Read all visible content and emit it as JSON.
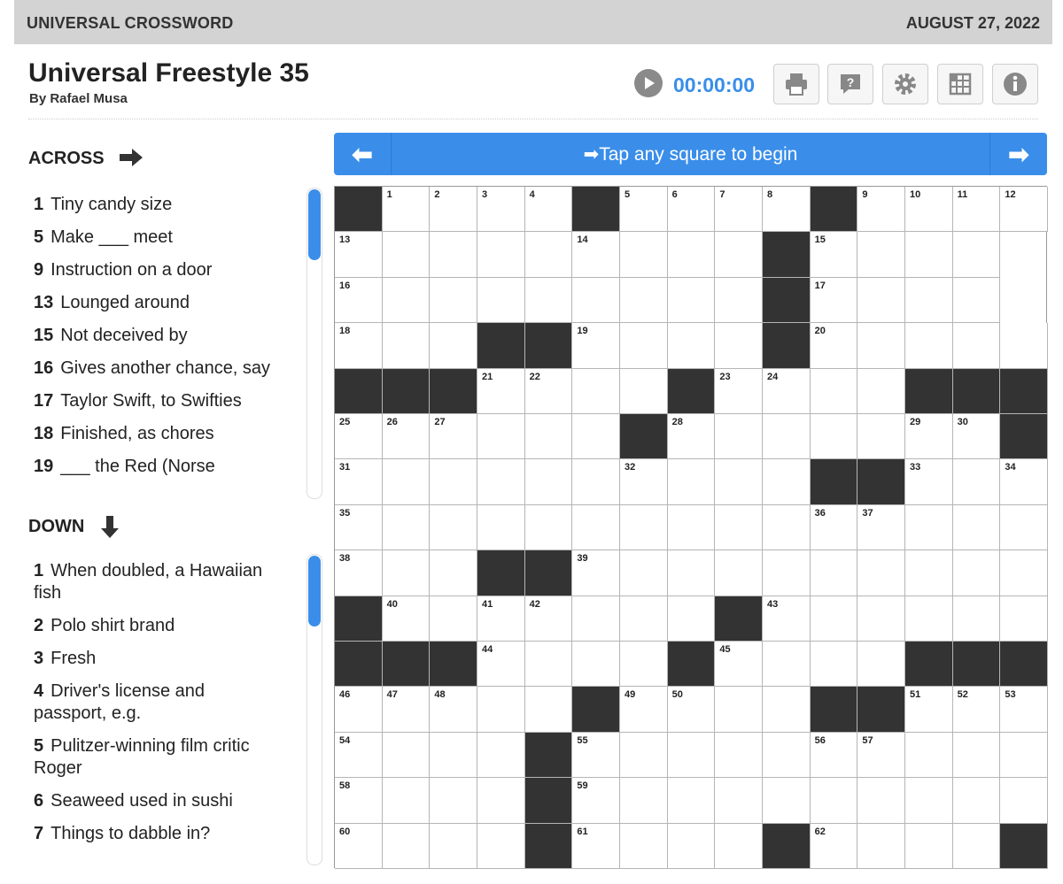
{
  "header": {
    "brand": "UNIVERSAL CROSSWORD",
    "date": "AUGUST 27, 2022"
  },
  "puzzle": {
    "title": "Universal Freestyle 35",
    "author": "By Rafael Musa"
  },
  "toolbar": {
    "timer": "00:00:00",
    "buttons": [
      "play-icon",
      "print-icon",
      "help-icon",
      "gear-icon",
      "grid-icon",
      "info-icon"
    ]
  },
  "banner": {
    "message": "➡Tap any square to begin",
    "prev": "⬅",
    "next": "➡"
  },
  "across": {
    "label": "ACROSS",
    "clues": [
      {
        "num": "1",
        "text": "Tiny candy size"
      },
      {
        "num": "5",
        "text": "Make ___ meet"
      },
      {
        "num": "9",
        "text": "Instruction on a door"
      },
      {
        "num": "13",
        "text": "Lounged around"
      },
      {
        "num": "15",
        "text": "Not deceived by"
      },
      {
        "num": "16",
        "text": "Gives another chance, say"
      },
      {
        "num": "17",
        "text": "Taylor Swift, to Swifties"
      },
      {
        "num": "18",
        "text": "Finished, as chores"
      },
      {
        "num": "19",
        "text": "___ the Red (Norse"
      }
    ]
  },
  "down": {
    "label": "DOWN",
    "clues": [
      {
        "num": "1",
        "text": "When doubled, a Hawaiian fish"
      },
      {
        "num": "2",
        "text": "Polo shirt brand"
      },
      {
        "num": "3",
        "text": "Fresh"
      },
      {
        "num": "4",
        "text": "Driver's license and passport, e.g."
      },
      {
        "num": "5",
        "text": "Pulitzer-winning film critic Roger"
      },
      {
        "num": "6",
        "text": "Seaweed used in sushi"
      },
      {
        "num": "7",
        "text": "Things to dabble in?"
      }
    ]
  },
  "grid": {
    "size": 15,
    "rows": [
      "#1 2 3 4 #5 6 7 8 #9 10 11 12",
      "13 . . . . 14 . . . # 15 . . .",
      "16 . . . . . . . . # 17 . . .",
      "18 . . # # 19 . . . # 20 . . . .",
      "# # # 21 22 . . # 23 24 . . # # #",
      "25 26 27 . . . # 28 . . . . 29 30 #",
      "31 . . . . . 32 . . . # # 33 . 34",
      "35 . . . . . . . . . 36 37 . . .",
      "38 . . # # 39 . . . . . . . . .",
      "# 40 . 41 42 . . . # 43 . . . . .",
      "# # # 44 . . . # 45 . . . # # #",
      "46 47 48 . . # 49 50 . . # # 51 52 53",
      "54 . . . # 55 . . . . 56 57 . . .",
      "58 . . . # 59 . . . . . . . . .",
      "60 . . . # 61 . . . # 62 . . . #"
    ]
  }
}
